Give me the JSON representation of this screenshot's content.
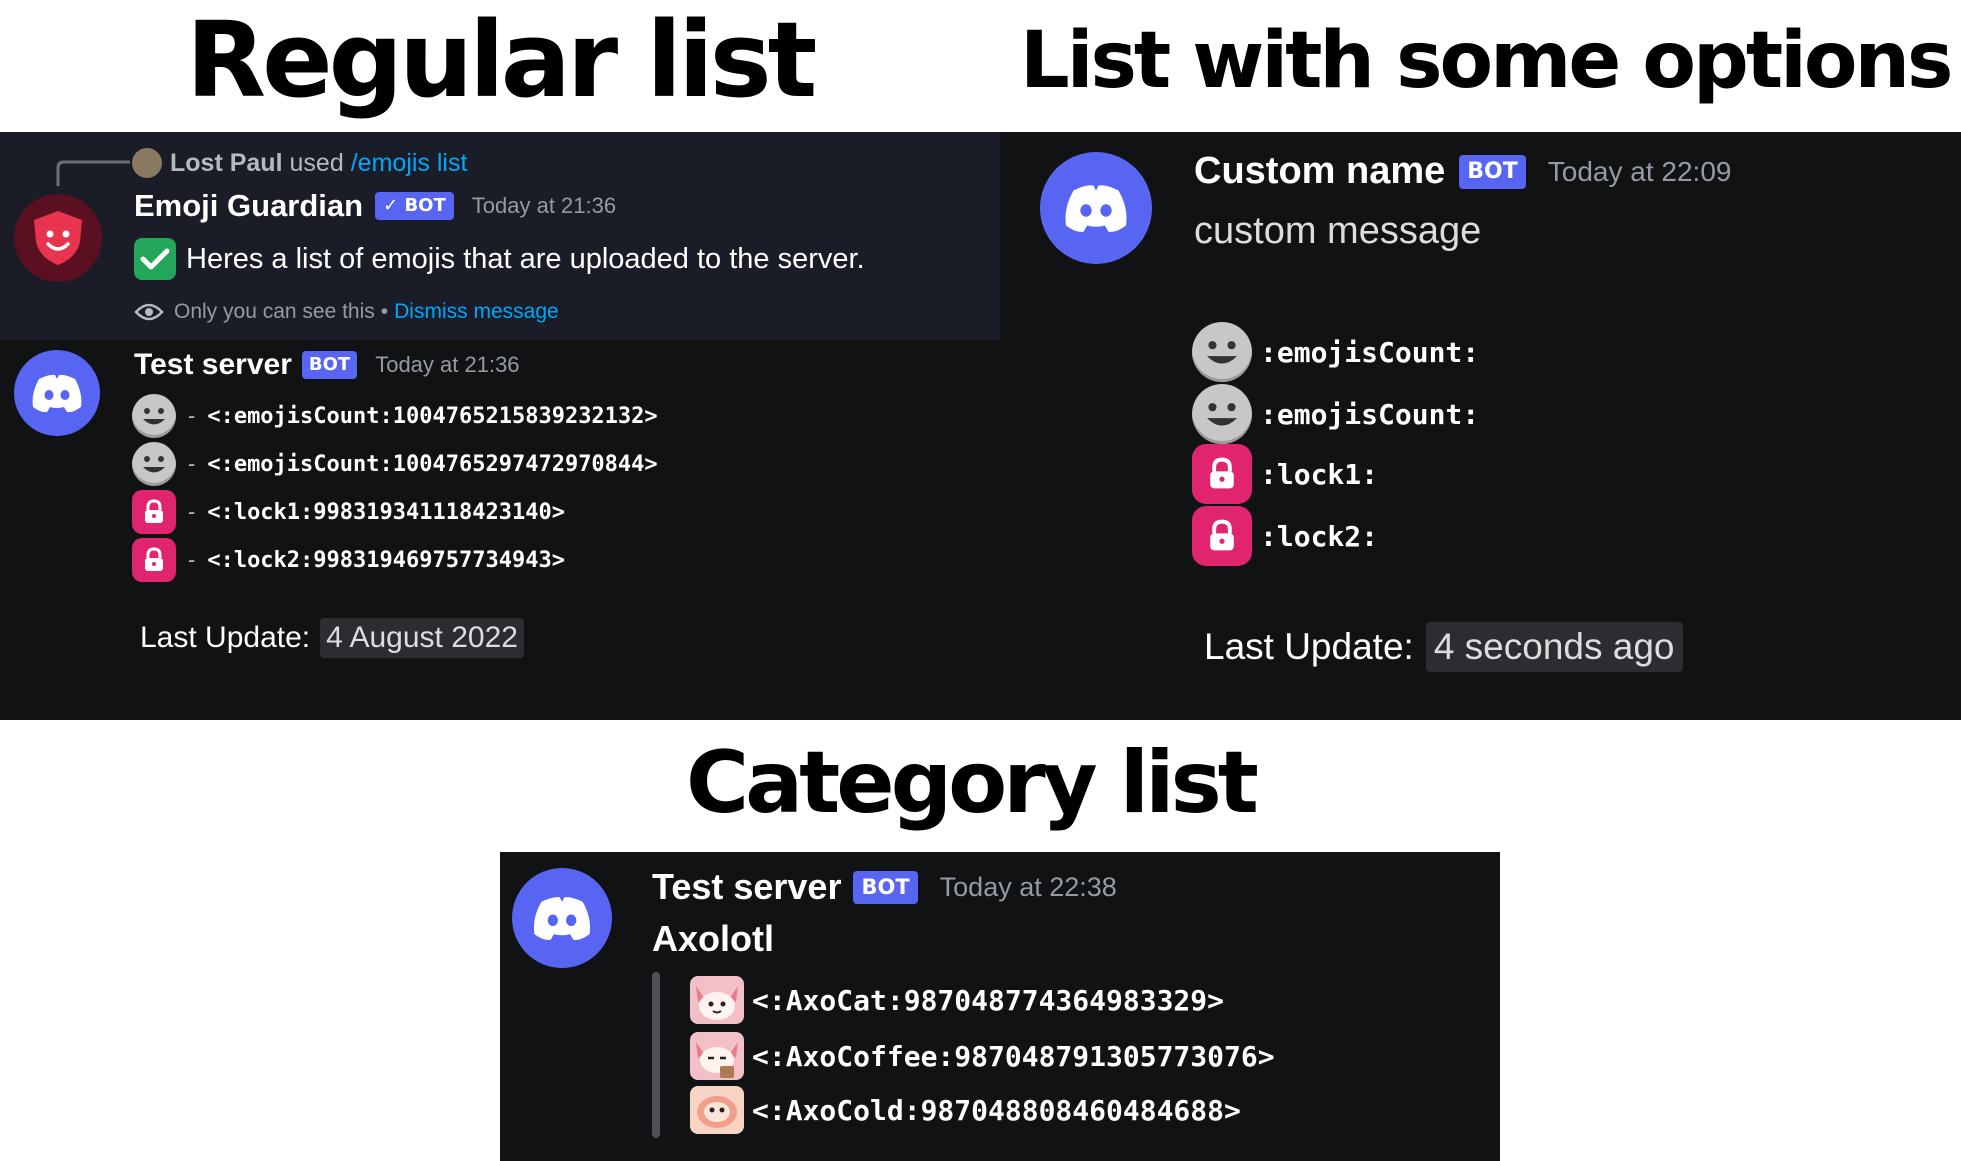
{
  "headings": {
    "regular": "Regular list",
    "options": "List with some options",
    "category": "Category list"
  },
  "regular": {
    "reply": {
      "user": "Lost Paul",
      "used": "used",
      "command": "/emojis list"
    },
    "guardian": {
      "name": "Emoji Guardian",
      "badge": "✓ BOT",
      "timestamp": "Today at 21:36",
      "message": "Heres a list of emojis that are uploaded to the server.",
      "ephemeral_note": "Only you can see this",
      "dot": "•",
      "dismiss": "Dismiss message"
    },
    "bot": {
      "name": "Test server",
      "badge": "BOT",
      "timestamp": "Today at 21:36",
      "dash": "-",
      "items": [
        {
          "icon": "smile-emoji-icon",
          "code": "<:emojisCount:1004765215839232132>"
        },
        {
          "icon": "smile-emoji-icon",
          "code": "<:emojisCount:1004765297472970844>"
        },
        {
          "icon": "lock-emoji-icon",
          "code": "<:lock1:998319341118423140>"
        },
        {
          "icon": "lock-emoji-icon",
          "code": "<:lock2:998319469757734943>"
        }
      ],
      "last_update_label": "Last Update:",
      "last_update_value": "4 August 2022"
    }
  },
  "options": {
    "name": "Custom name",
    "badge": "BOT",
    "timestamp": "Today at 22:09",
    "message": "custom message",
    "items": [
      {
        "icon": "smile-emoji-icon",
        "code": ":emojisCount:"
      },
      {
        "icon": "smile-emoji-icon",
        "code": ":emojisCount:"
      },
      {
        "icon": "lock-emoji-icon",
        "code": ":lock1:"
      },
      {
        "icon": "lock-emoji-icon",
        "code": ":lock2:"
      }
    ],
    "last_update_label": "Last Update:",
    "last_update_value": "4 seconds ago"
  },
  "category": {
    "name": "Test server",
    "badge": "BOT",
    "timestamp": "Today at 22:38",
    "title": "Axolotl",
    "items": [
      {
        "icon": "axocat-emoji-icon",
        "code": "<:AxoCat:987048774364983329>"
      },
      {
        "icon": "axocoffee-emoji-icon",
        "code": "<:AxoCoffee:987048791305773076>"
      },
      {
        "icon": "axocold-emoji-icon",
        "code": "<:AxoCold:987048808460484688>"
      }
    ]
  },
  "colors": {
    "blurple": "#5865f2",
    "panel": "#111214",
    "highlight": "#1a1c28",
    "link": "#00a8fc",
    "lock": "#e0246e",
    "check": "#23a55a"
  }
}
